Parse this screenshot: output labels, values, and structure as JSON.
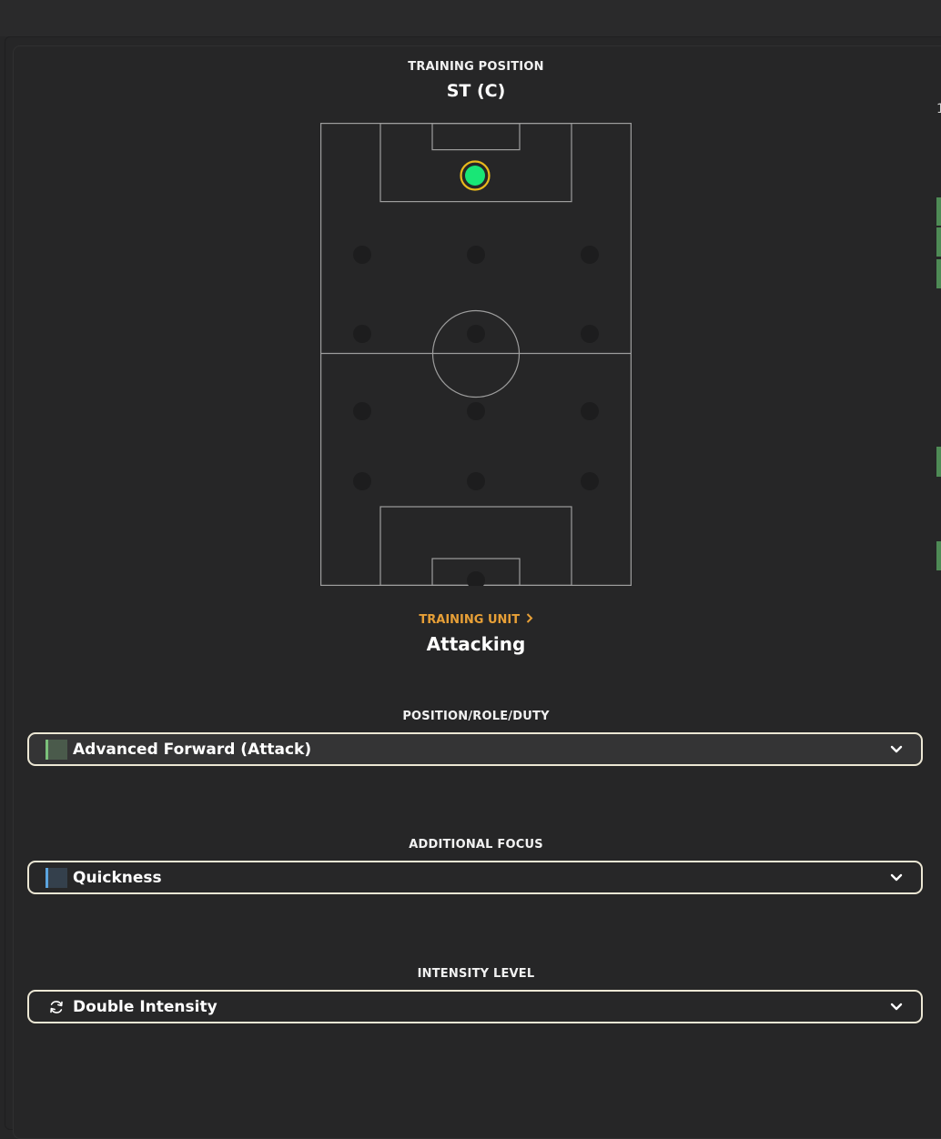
{
  "training_position": {
    "label": "TRAINING POSITION",
    "value": "ST (C)"
  },
  "training_unit": {
    "label": "TRAINING UNIT",
    "chevron_icon": "chevron-right-icon",
    "value": "Attacking"
  },
  "position_role_duty": {
    "label": "POSITION/ROLE/DUTY",
    "selected": "Advanced Forward (Attack)",
    "swatch_color": "#4a5a4b",
    "accent_color": "#7bbf7a"
  },
  "additional_focus": {
    "label": "ADDITIONAL FOCUS",
    "selected": "Quickness",
    "swatch_color": "#34404c",
    "accent_color": "#5ba4df"
  },
  "intensity_level": {
    "label": "INTENSITY LEVEL",
    "selected": "Double Intensity",
    "icon": "refresh-icon"
  },
  "colors": {
    "background": "#262627",
    "pitch_line": "#9d9d9d",
    "active_marker": "#19e676",
    "active_ring": "#e8b91c",
    "accent_orange": "#e8a037",
    "dropdown_border": "#ece7d4"
  }
}
